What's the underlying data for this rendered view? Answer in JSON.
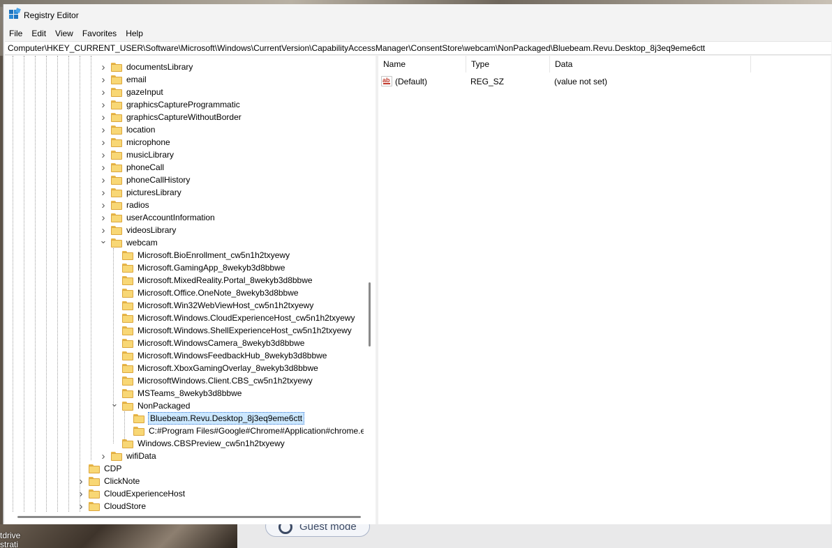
{
  "window": {
    "title": "Registry Editor"
  },
  "menu": [
    "File",
    "Edit",
    "View",
    "Favorites",
    "Help"
  ],
  "address": "Computer\\HKEY_CURRENT_USER\\Software\\Microsoft\\Windows\\CurrentVersion\\CapabilityAccessManager\\ConsentStore\\webcam\\NonPackaged\\Bluebeam.Revu.Desktop_8j3eq9eme6ctt",
  "tree": [
    {
      "label": "documentsLibrary",
      "level": 0,
      "expander": "collapsed"
    },
    {
      "label": "email",
      "level": 0,
      "expander": "collapsed"
    },
    {
      "label": "gazeInput",
      "level": 0,
      "expander": "collapsed"
    },
    {
      "label": "graphicsCaptureProgrammatic",
      "level": 0,
      "expander": "collapsed"
    },
    {
      "label": "graphicsCaptureWithoutBorder",
      "level": 0,
      "expander": "collapsed"
    },
    {
      "label": "location",
      "level": 0,
      "expander": "collapsed"
    },
    {
      "label": "microphone",
      "level": 0,
      "expander": "collapsed"
    },
    {
      "label": "musicLibrary",
      "level": 0,
      "expander": "collapsed"
    },
    {
      "label": "phoneCall",
      "level": 0,
      "expander": "collapsed"
    },
    {
      "label": "phoneCallHistory",
      "level": 0,
      "expander": "collapsed"
    },
    {
      "label": "picturesLibrary",
      "level": 0,
      "expander": "collapsed"
    },
    {
      "label": "radios",
      "level": 0,
      "expander": "collapsed"
    },
    {
      "label": "userAccountInformation",
      "level": 0,
      "expander": "collapsed"
    },
    {
      "label": "videosLibrary",
      "level": 0,
      "expander": "collapsed"
    },
    {
      "label": "webcam",
      "level": 0,
      "expander": "expanded"
    },
    {
      "label": "Microsoft.BioEnrollment_cw5n1h2txyewy",
      "level": 1,
      "expander": "none"
    },
    {
      "label": "Microsoft.GamingApp_8wekyb3d8bbwe",
      "level": 1,
      "expander": "none"
    },
    {
      "label": "Microsoft.MixedReality.Portal_8wekyb3d8bbwe",
      "level": 1,
      "expander": "none"
    },
    {
      "label": "Microsoft.Office.OneNote_8wekyb3d8bbwe",
      "level": 1,
      "expander": "none"
    },
    {
      "label": "Microsoft.Win32WebViewHost_cw5n1h2txyewy",
      "level": 1,
      "expander": "none"
    },
    {
      "label": "Microsoft.Windows.CloudExperienceHost_cw5n1h2txyewy",
      "level": 1,
      "expander": "none"
    },
    {
      "label": "Microsoft.Windows.ShellExperienceHost_cw5n1h2txyewy",
      "level": 1,
      "expander": "none"
    },
    {
      "label": "Microsoft.WindowsCamera_8wekyb3d8bbwe",
      "level": 1,
      "expander": "none"
    },
    {
      "label": "Microsoft.WindowsFeedbackHub_8wekyb3d8bbwe",
      "level": 1,
      "expander": "none"
    },
    {
      "label": "Microsoft.XboxGamingOverlay_8wekyb3d8bbwe",
      "level": 1,
      "expander": "none"
    },
    {
      "label": "MicrosoftWindows.Client.CBS_cw5n1h2txyewy",
      "level": 1,
      "expander": "none"
    },
    {
      "label": "MSTeams_8wekyb3d8bbwe",
      "level": 1,
      "expander": "none"
    },
    {
      "label": "NonPackaged",
      "level": 1,
      "expander": "expanded"
    },
    {
      "label": "Bluebeam.Revu.Desktop_8j3eq9eme6ctt",
      "level": 2,
      "expander": "none",
      "selected": true
    },
    {
      "label": "C:#Program Files#Google#Chrome#Application#chrome.exe",
      "level": 2,
      "expander": "none"
    },
    {
      "label": "Windows.CBSPreview_cw5n1h2txyewy",
      "level": 1,
      "expander": "none"
    },
    {
      "label": "wifiData",
      "level": 0,
      "expander": "collapsed"
    },
    {
      "label": "CDP",
      "level": -2,
      "expander": "none"
    },
    {
      "label": "ClickNote",
      "level": -2,
      "expander": "collapsed"
    },
    {
      "label": "CloudExperienceHost",
      "level": -2,
      "expander": "collapsed"
    },
    {
      "label": "CloudStore",
      "level": -2,
      "expander": "collapsed"
    }
  ],
  "values": {
    "headers": {
      "name": "Name",
      "type": "Type",
      "data": "Data"
    },
    "rows": [
      {
        "name": "(Default)",
        "type": "REG_SZ",
        "data": "(value not set)",
        "icon": "string-value-icon"
      }
    ]
  },
  "background": {
    "guest_mode_label": "Guest mode",
    "desktop_text_1": "tdrive",
    "desktop_text_2": "strati"
  },
  "colors": {
    "selection_bg": "#cce8ff",
    "folder": "#f8d775",
    "window_bg": "#f3f3f3"
  }
}
